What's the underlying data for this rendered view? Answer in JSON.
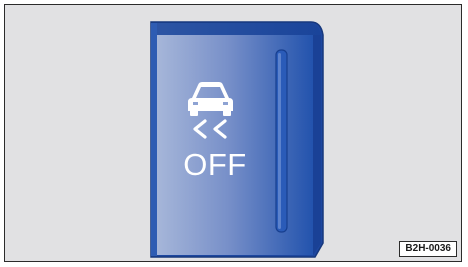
{
  "button": {
    "label": "OFF",
    "icon": "traction-control-off-icon"
  },
  "image_code": "B2H-0036",
  "colors": {
    "background": "#e1e1e3",
    "button_dark": "#1f4ea0",
    "button_light": "#a6b6d9",
    "button_edge": "#1b3f86",
    "text": "#ffffff"
  }
}
